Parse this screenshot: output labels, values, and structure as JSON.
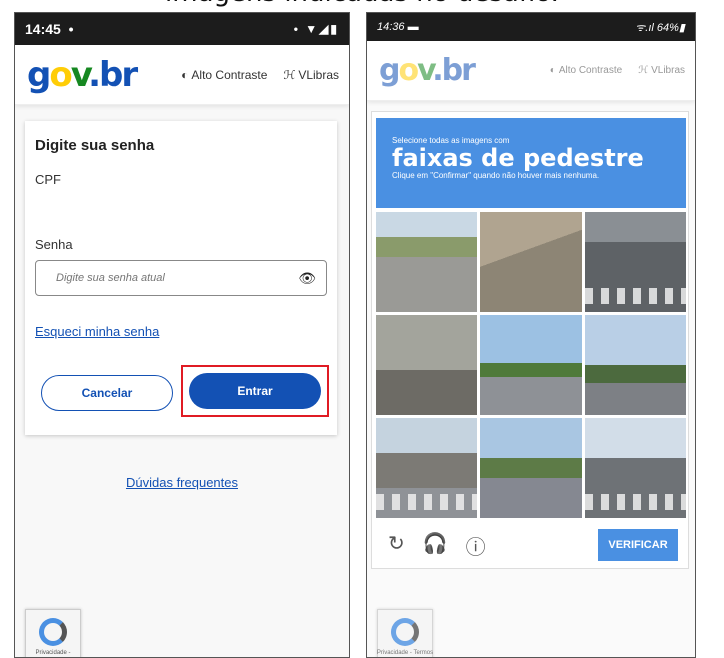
{
  "caption": "imagens indicadas no desafio.",
  "left": {
    "status": {
      "time": "14:45",
      "dot": "•",
      "icons": "• ▼◢▮"
    },
    "logo": {
      "g": "g",
      "o": "o",
      "v": "v",
      "d": ".",
      "br": "br"
    },
    "a11y": {
      "contrast_icon": "◐",
      "contrast": "Alto Contraste",
      "libras_icon": "ℋ",
      "libras": "VLibras"
    },
    "card": {
      "title": "Digite sua senha",
      "cpf_label": "CPF",
      "password_label": "Senha",
      "password_placeholder": "Digite sua senha atual",
      "eye_icon": "👁",
      "forgot": "Esqueci minha senha",
      "cancel": "Cancelar",
      "enter": "Entrar"
    },
    "faq": "Dúvidas frequentes",
    "recaptcha_text": "Privacidade -"
  },
  "right": {
    "status": {
      "time": "14:36",
      "sim_icon": "▬",
      "icons": "ᯤ.ıl 64%▮"
    },
    "logo": {
      "g": "g",
      "o": "o",
      "v": "v",
      "d": ".",
      "br": "br"
    },
    "a11y": {
      "contrast_icon": "◐",
      "contrast": "Alto Contraste",
      "libras_icon": "ℋ",
      "libras": "VLibras"
    },
    "captcha": {
      "line1": "Selecione todas as imagens com",
      "line2": "faixas de pedestre",
      "line3": "Clique em \"Confirmar\" quando não houver mais nenhuma.",
      "reload_icon": "↻",
      "audio_icon": "🎧",
      "info_icon": "ⓘ",
      "verify": "VERIFICAR"
    },
    "recaptcha_text": "Privacidade - Termos"
  }
}
